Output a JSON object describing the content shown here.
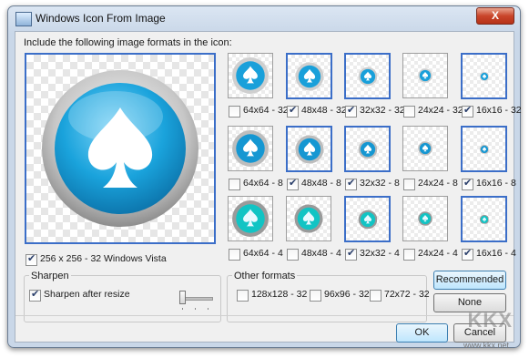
{
  "window": {
    "title": "Windows Icon From Image",
    "close_glyph": "X"
  },
  "header_label": "Include the following image formats in the icon:",
  "main_preview": {
    "checked": true,
    "size_label": "256 x 256 - 32",
    "os_label": "Windows Vista"
  },
  "grid": {
    "rows": [
      {
        "depth": "32",
        "style": "glossy",
        "cells": [
          {
            "label": "64x64 - 32",
            "checked": false
          },
          {
            "label": "48x48 - 32",
            "checked": true
          },
          {
            "label": "32x32 - 32",
            "checked": true
          },
          {
            "label": "24x24 - 32",
            "checked": false
          },
          {
            "label": "16x16 - 32",
            "checked": true
          }
        ]
      },
      {
        "depth": "8",
        "style": "flat",
        "cells": [
          {
            "label": "64x64 - 8",
            "checked": false
          },
          {
            "label": "48x48 - 8",
            "checked": true
          },
          {
            "label": "32x32 - 8",
            "checked": true
          },
          {
            "label": "24x24 - 8",
            "checked": false
          },
          {
            "label": "16x16 - 8",
            "checked": true
          }
        ]
      },
      {
        "depth": "4",
        "style": "posterized",
        "cells": [
          {
            "label": "64x64 - 4",
            "checked": false
          },
          {
            "label": "48x48 - 4",
            "checked": false
          },
          {
            "label": "32x32 - 4",
            "checked": true
          },
          {
            "label": "24x24 - 4",
            "checked": false
          },
          {
            "label": "16x16 - 4",
            "checked": true
          }
        ]
      }
    ]
  },
  "sharpen": {
    "group_label": "Sharpen",
    "checkbox_label": "Sharpen after resize",
    "checked": true
  },
  "other_formats": {
    "group_label": "Other formats",
    "items": [
      {
        "label": "128x128 - 32",
        "checked": false
      },
      {
        "label": "96x96 - 32",
        "checked": false
      },
      {
        "label": "72x72 - 32",
        "checked": false
      }
    ]
  },
  "buttons": {
    "recommended": "Recommended",
    "none": "None",
    "ok": "OK",
    "cancel": "Cancel"
  },
  "watermark": {
    "logo": "KKX",
    "url": "www.kkx.net"
  },
  "colors": {
    "selection_border": "#3b6ec8",
    "icon_blue": "#1aa3dc",
    "button_default_border": "#3c7fb1"
  }
}
